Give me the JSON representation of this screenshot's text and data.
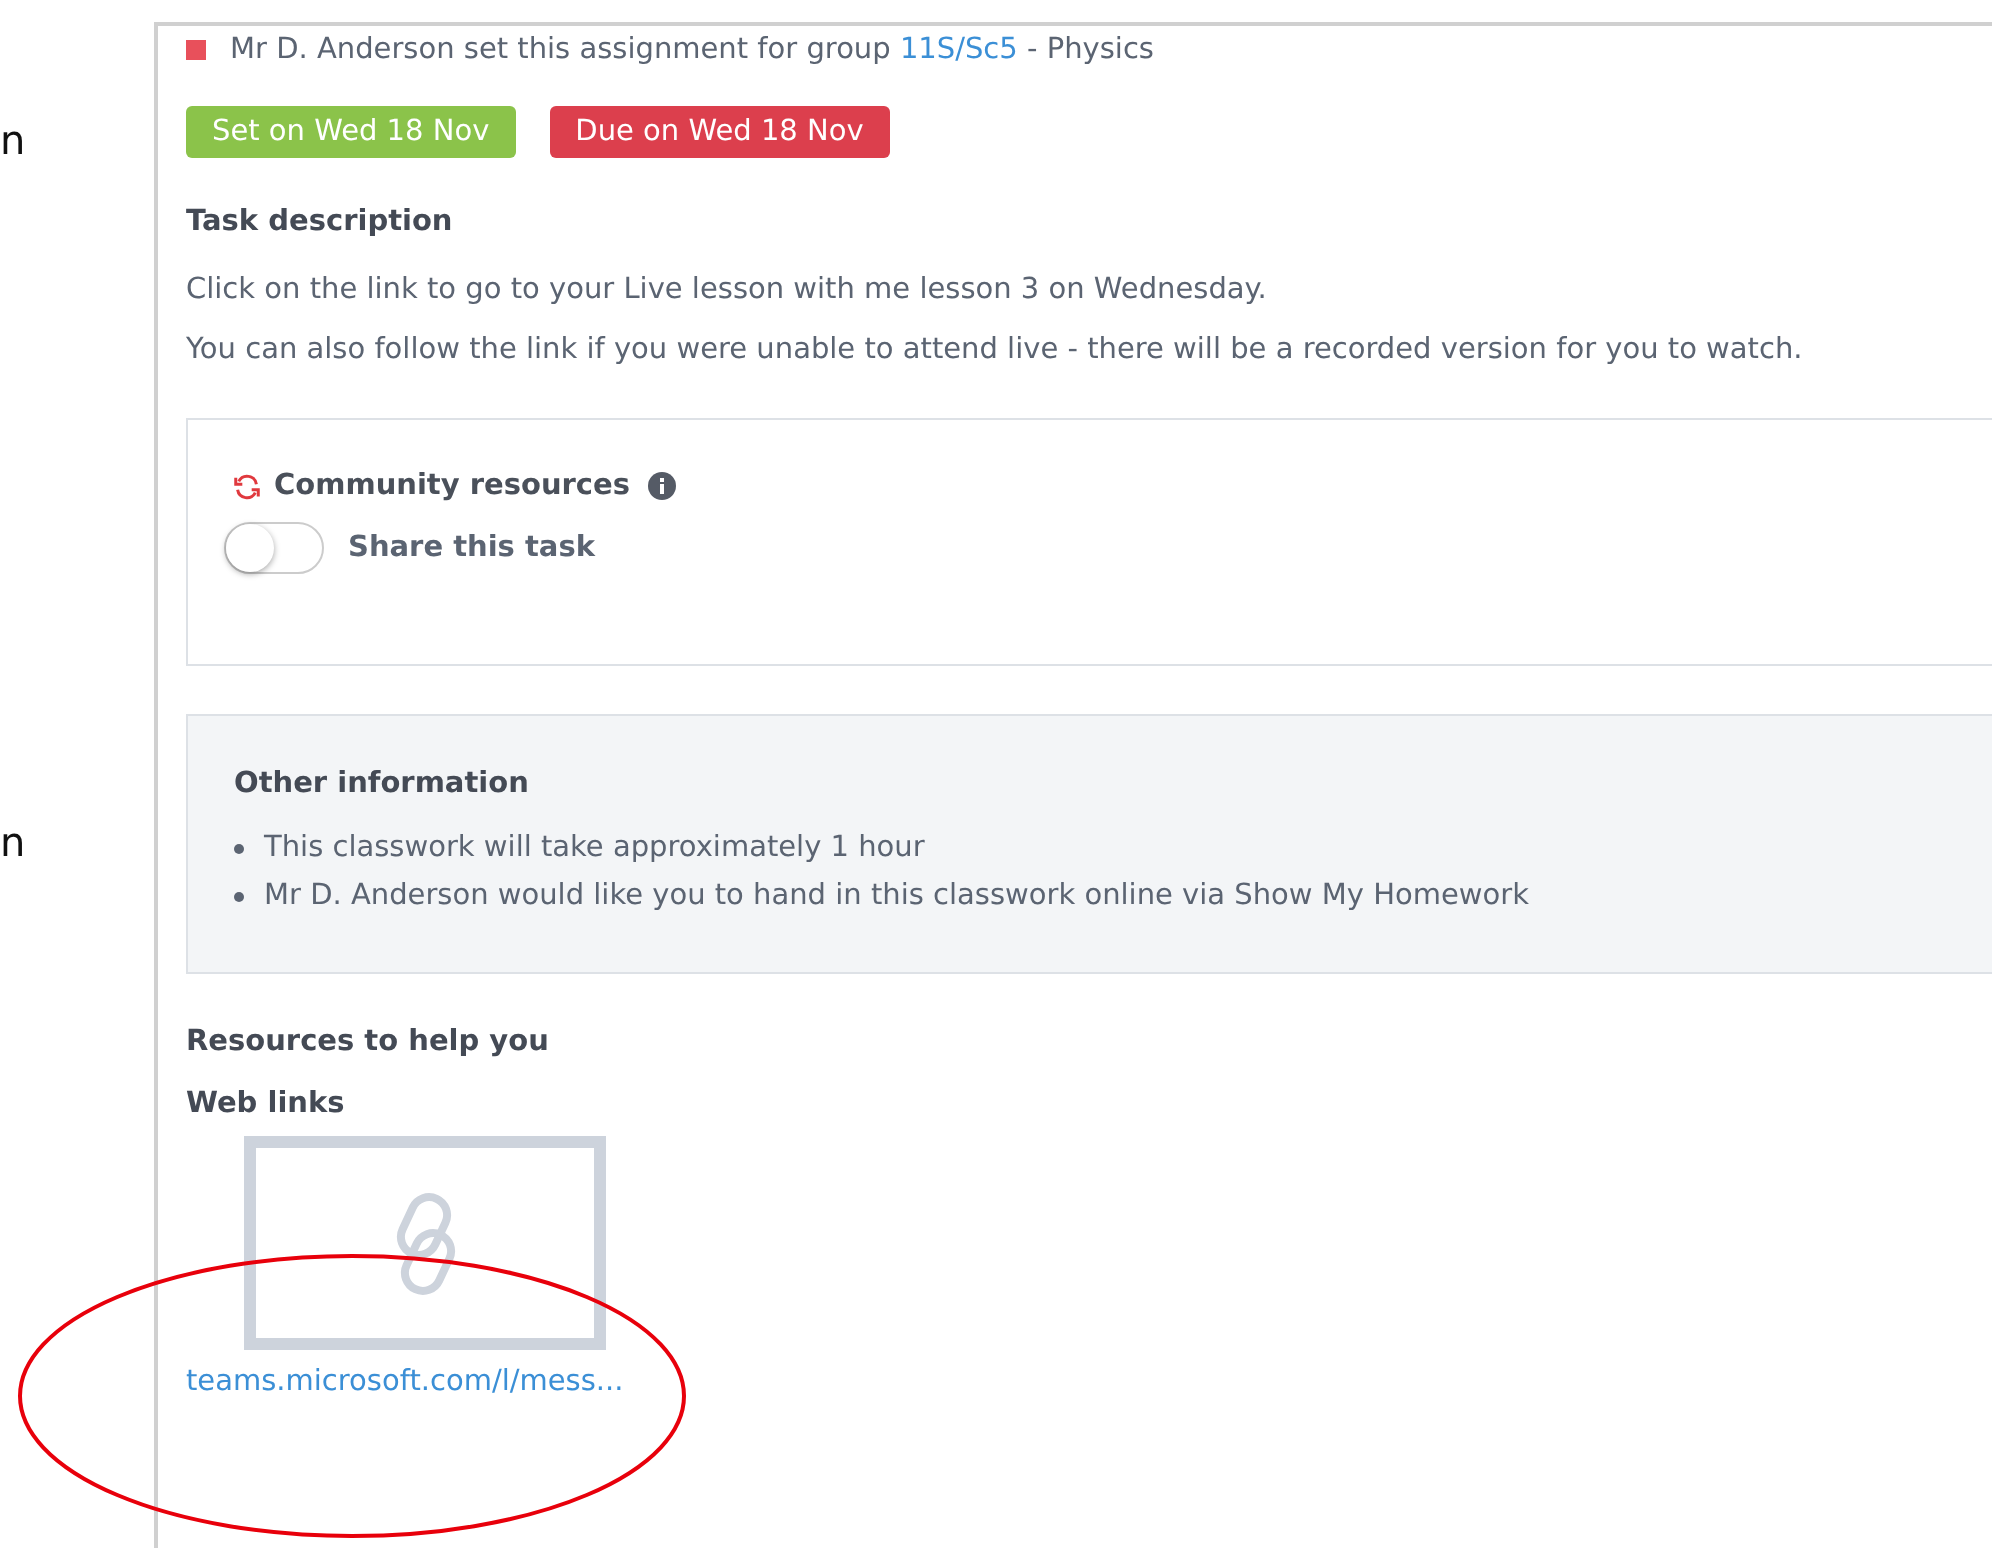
{
  "margin_fragments": [
    "n",
    "n"
  ],
  "assignment": {
    "setter_text": "Mr D. Anderson set this assignment for group",
    "group_link": "11S/Sc5",
    "subject": "- Physics",
    "set_badge": "Set on Wed 18 Nov",
    "due_badge": "Due on Wed 18 Nov"
  },
  "task_description": {
    "heading": "Task description",
    "paragraphs": [
      "Click on the link to go to your Live lesson with me lesson 3 on Wednesday.",
      "You can also follow the link if you were unable to attend live - there will be a recorded version for you to watch."
    ]
  },
  "community_resources": {
    "title": "Community resources",
    "toggle_label": "Share this task",
    "on": false
  },
  "other_information": {
    "heading": "Other information",
    "items": [
      "This classwork will take approximately 1 hour",
      "Mr D. Anderson would like you to hand in this classwork online via Show My Homework"
    ]
  },
  "resources": {
    "heading": "Resources to help you",
    "subheading": "Web links",
    "links": [
      {
        "url": "teams.microsoft.com/l/mess..."
      }
    ]
  }
}
